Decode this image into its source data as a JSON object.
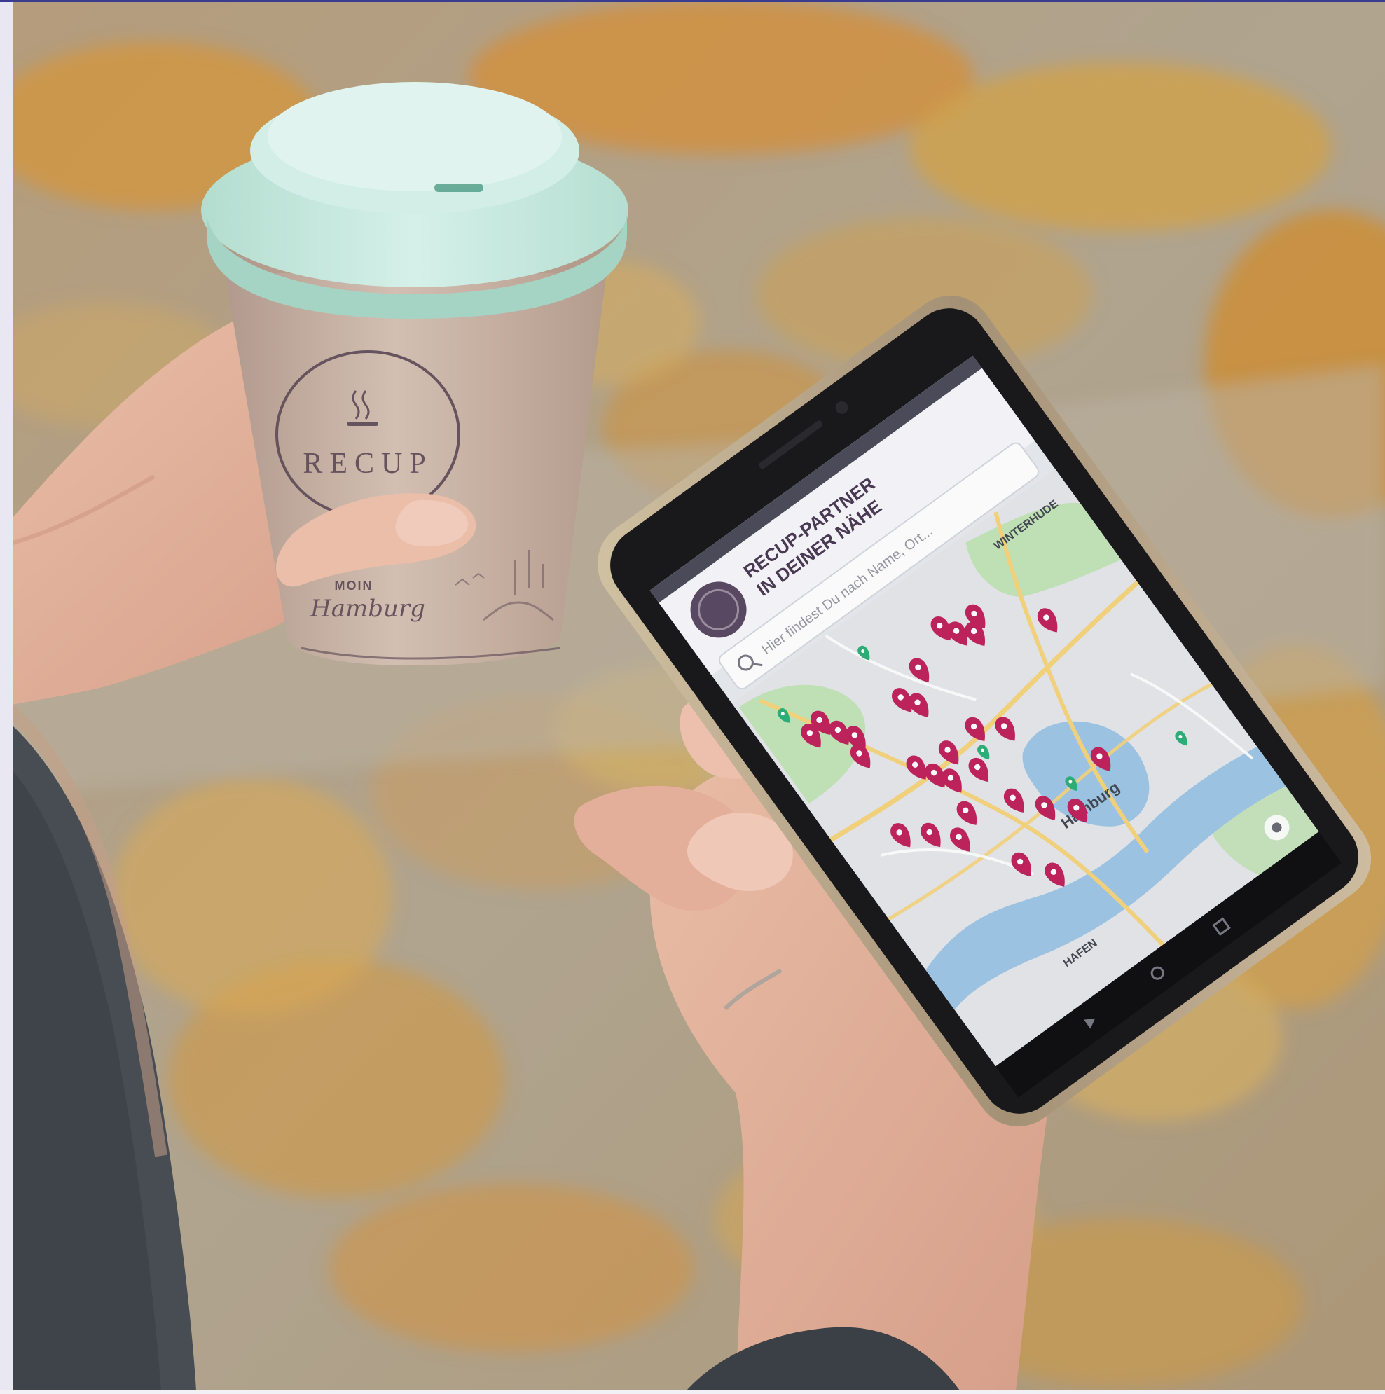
{
  "photo": {
    "colors": {
      "ground": "#b4a892",
      "leaf_orange": "#d99a3a",
      "leaf_yellow": "#e8c25a",
      "cup_body": "#c7b2a3",
      "cup_lid": "#c9ebe0",
      "cup_print": "#6a5560",
      "skin": "#e9b9a2",
      "sleeve_dark": "#4a4e55",
      "phone_frame": "#b9aa92",
      "phone_screen": "#121215",
      "map_land": "#e7eaee",
      "map_water": "#9fc6e6",
      "map_park": "#bfe3b2",
      "map_road": "#f6d57e",
      "pin_color": "#c0245d",
      "partner_pin_color": "#2fb07a"
    },
    "cup": {
      "brand": "RECUP",
      "line1": "MOIN",
      "line2": "Hamburg"
    },
    "phone_app": {
      "header_line1": "RECUP-PARTNER",
      "header_line2": "IN DEINER NÄHE",
      "search_placeholder": "Hier findest Du nach Name, Ort...",
      "map_labels": {
        "city": "Hamburg",
        "harbor": "HAFEN",
        "district": "WINTERHUDE"
      },
      "pin_count": 30,
      "partner_pin_count": 5
    }
  }
}
